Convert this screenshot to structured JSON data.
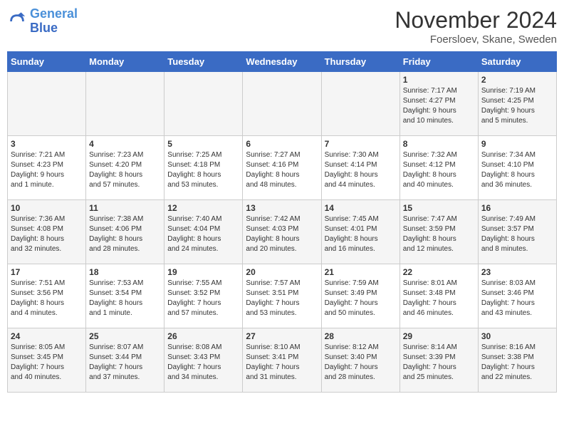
{
  "logo": {
    "line1": "General",
    "line2": "Blue"
  },
  "title": "November 2024",
  "subtitle": "Foersloev, Skane, Sweden",
  "weekdays": [
    "Sunday",
    "Monday",
    "Tuesday",
    "Wednesday",
    "Thursday",
    "Friday",
    "Saturday"
  ],
  "weeks": [
    [
      {
        "day": "",
        "info": ""
      },
      {
        "day": "",
        "info": ""
      },
      {
        "day": "",
        "info": ""
      },
      {
        "day": "",
        "info": ""
      },
      {
        "day": "",
        "info": ""
      },
      {
        "day": "1",
        "info": "Sunrise: 7:17 AM\nSunset: 4:27 PM\nDaylight: 9 hours\nand 10 minutes."
      },
      {
        "day": "2",
        "info": "Sunrise: 7:19 AM\nSunset: 4:25 PM\nDaylight: 9 hours\nand 5 minutes."
      }
    ],
    [
      {
        "day": "3",
        "info": "Sunrise: 7:21 AM\nSunset: 4:23 PM\nDaylight: 9 hours\nand 1 minute."
      },
      {
        "day": "4",
        "info": "Sunrise: 7:23 AM\nSunset: 4:20 PM\nDaylight: 8 hours\nand 57 minutes."
      },
      {
        "day": "5",
        "info": "Sunrise: 7:25 AM\nSunset: 4:18 PM\nDaylight: 8 hours\nand 53 minutes."
      },
      {
        "day": "6",
        "info": "Sunrise: 7:27 AM\nSunset: 4:16 PM\nDaylight: 8 hours\nand 48 minutes."
      },
      {
        "day": "7",
        "info": "Sunrise: 7:30 AM\nSunset: 4:14 PM\nDaylight: 8 hours\nand 44 minutes."
      },
      {
        "day": "8",
        "info": "Sunrise: 7:32 AM\nSunset: 4:12 PM\nDaylight: 8 hours\nand 40 minutes."
      },
      {
        "day": "9",
        "info": "Sunrise: 7:34 AM\nSunset: 4:10 PM\nDaylight: 8 hours\nand 36 minutes."
      }
    ],
    [
      {
        "day": "10",
        "info": "Sunrise: 7:36 AM\nSunset: 4:08 PM\nDaylight: 8 hours\nand 32 minutes."
      },
      {
        "day": "11",
        "info": "Sunrise: 7:38 AM\nSunset: 4:06 PM\nDaylight: 8 hours\nand 28 minutes."
      },
      {
        "day": "12",
        "info": "Sunrise: 7:40 AM\nSunset: 4:04 PM\nDaylight: 8 hours\nand 24 minutes."
      },
      {
        "day": "13",
        "info": "Sunrise: 7:42 AM\nSunset: 4:03 PM\nDaylight: 8 hours\nand 20 minutes."
      },
      {
        "day": "14",
        "info": "Sunrise: 7:45 AM\nSunset: 4:01 PM\nDaylight: 8 hours\nand 16 minutes."
      },
      {
        "day": "15",
        "info": "Sunrise: 7:47 AM\nSunset: 3:59 PM\nDaylight: 8 hours\nand 12 minutes."
      },
      {
        "day": "16",
        "info": "Sunrise: 7:49 AM\nSunset: 3:57 PM\nDaylight: 8 hours\nand 8 minutes."
      }
    ],
    [
      {
        "day": "17",
        "info": "Sunrise: 7:51 AM\nSunset: 3:56 PM\nDaylight: 8 hours\nand 4 minutes."
      },
      {
        "day": "18",
        "info": "Sunrise: 7:53 AM\nSunset: 3:54 PM\nDaylight: 8 hours\nand 1 minute."
      },
      {
        "day": "19",
        "info": "Sunrise: 7:55 AM\nSunset: 3:52 PM\nDaylight: 7 hours\nand 57 minutes."
      },
      {
        "day": "20",
        "info": "Sunrise: 7:57 AM\nSunset: 3:51 PM\nDaylight: 7 hours\nand 53 minutes."
      },
      {
        "day": "21",
        "info": "Sunrise: 7:59 AM\nSunset: 3:49 PM\nDaylight: 7 hours\nand 50 minutes."
      },
      {
        "day": "22",
        "info": "Sunrise: 8:01 AM\nSunset: 3:48 PM\nDaylight: 7 hours\nand 46 minutes."
      },
      {
        "day": "23",
        "info": "Sunrise: 8:03 AM\nSunset: 3:46 PM\nDaylight: 7 hours\nand 43 minutes."
      }
    ],
    [
      {
        "day": "24",
        "info": "Sunrise: 8:05 AM\nSunset: 3:45 PM\nDaylight: 7 hours\nand 40 minutes."
      },
      {
        "day": "25",
        "info": "Sunrise: 8:07 AM\nSunset: 3:44 PM\nDaylight: 7 hours\nand 37 minutes."
      },
      {
        "day": "26",
        "info": "Sunrise: 8:08 AM\nSunset: 3:43 PM\nDaylight: 7 hours\nand 34 minutes."
      },
      {
        "day": "27",
        "info": "Sunrise: 8:10 AM\nSunset: 3:41 PM\nDaylight: 7 hours\nand 31 minutes."
      },
      {
        "day": "28",
        "info": "Sunrise: 8:12 AM\nSunset: 3:40 PM\nDaylight: 7 hours\nand 28 minutes."
      },
      {
        "day": "29",
        "info": "Sunrise: 8:14 AM\nSunset: 3:39 PM\nDaylight: 7 hours\nand 25 minutes."
      },
      {
        "day": "30",
        "info": "Sunrise: 8:16 AM\nSunset: 3:38 PM\nDaylight: 7 hours\nand 22 minutes."
      }
    ]
  ]
}
